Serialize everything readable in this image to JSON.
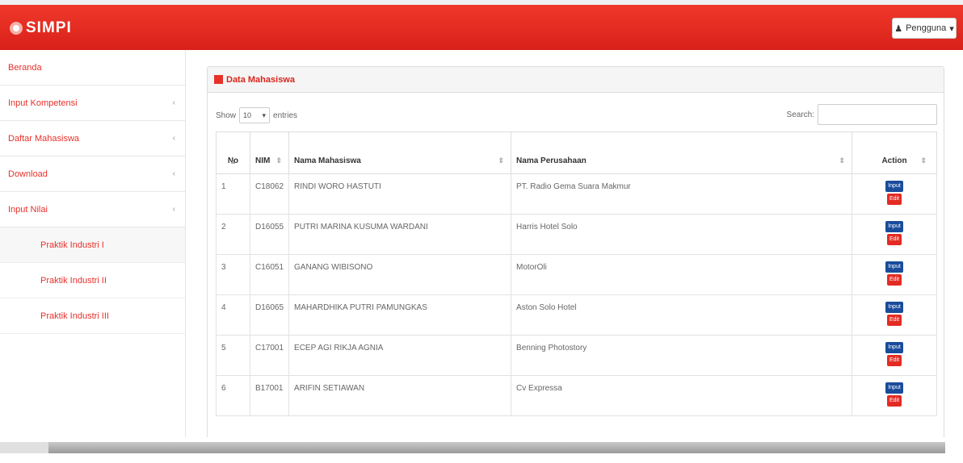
{
  "app": {
    "brand": "SIMPI",
    "user_label": "Pengguna",
    "user_caret": "▾"
  },
  "sidebar": {
    "items": [
      {
        "label": "Beranda",
        "has_arrow": false
      },
      {
        "label": "Input Kompetensi",
        "has_arrow": true
      },
      {
        "label": "Daftar Mahasiswa",
        "has_arrow": true
      },
      {
        "label": "Download",
        "has_arrow": true
      },
      {
        "label": "Input Nilai",
        "has_arrow": true
      }
    ],
    "subitems": [
      {
        "label": "Praktik Industri I",
        "active": true
      },
      {
        "label": "Praktik Industri II",
        "active": false
      },
      {
        "label": "Praktik Industri III",
        "active": false
      }
    ],
    "arrow_glyph": "‹"
  },
  "panel": {
    "title": "Data Mahasiswa"
  },
  "controls": {
    "show_label": "Show",
    "entries_value": "10",
    "entries_label": "entries",
    "search_label": "Search:"
  },
  "table": {
    "headers": {
      "no": "No",
      "nim": "NIM",
      "nama": "Nama Mahasiswa",
      "perusahaan": "Nama Perusahaan",
      "action": "Action"
    },
    "sort_up": "▲",
    "sort_both": "⇕",
    "rows": [
      {
        "no": "1",
        "nim": "C18062",
        "nama": "RINDI WORO HASTUTI",
        "perusahaan": "PT. Radio Gema Suara Makmur"
      },
      {
        "no": "2",
        "nim": "D16055",
        "nama": "PUTRI MARINA KUSUMA WARDANI",
        "perusahaan": "Harris Hotel Solo"
      },
      {
        "no": "3",
        "nim": "C16051",
        "nama": "GANANG WIBISONO",
        "perusahaan": "MotorOli"
      },
      {
        "no": "4",
        "nim": "D16065",
        "nama": "MAHARDHIKA PUTRI PAMUNGKAS",
        "perusahaan": "Aston Solo Hotel"
      },
      {
        "no": "5",
        "nim": "C17001",
        "nama": "ECEP AGI RIKJA AGNIA",
        "perusahaan": "Benning Photostory"
      },
      {
        "no": "6",
        "nim": "B17001",
        "nama": "ARIFIN SETIAWAN",
        "perusahaan": "Cv Expressa"
      }
    ],
    "btn_input": "Input",
    "btn_edit": "Edit"
  }
}
